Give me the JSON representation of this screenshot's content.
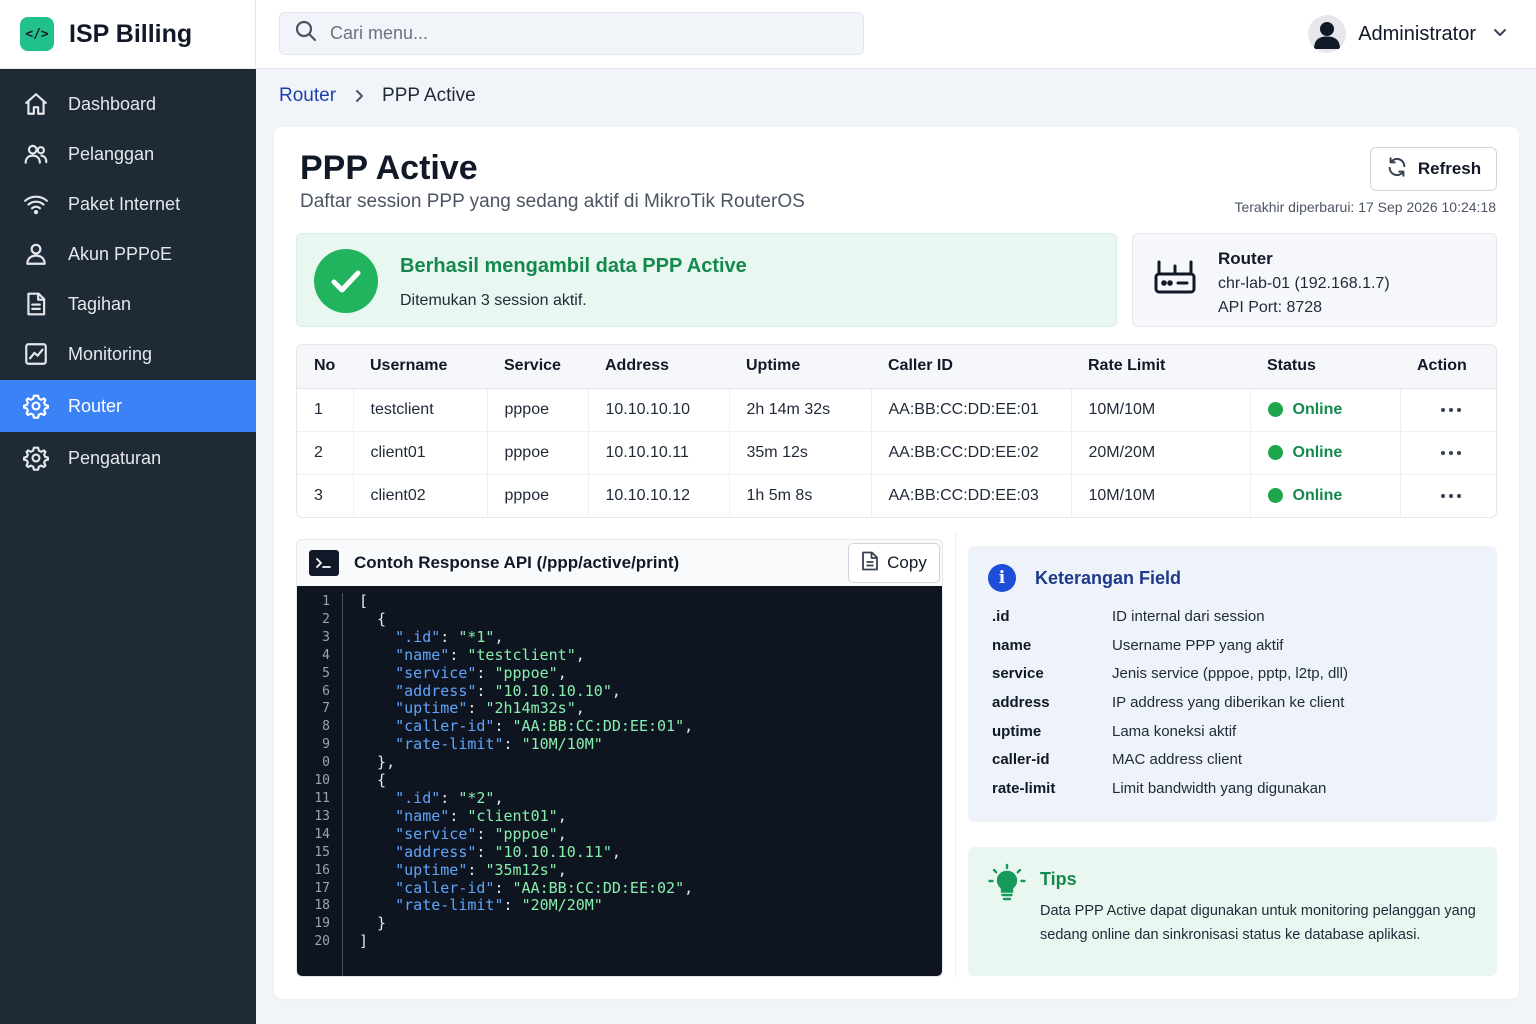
{
  "app": {
    "name": "ISP Billing",
    "logo_glyph": "</>",
    "accent": "#3b82f6",
    "brand_color": "#22c08a"
  },
  "search": {
    "placeholder": "Cari menu..."
  },
  "user": {
    "name": "Administrator"
  },
  "sidebar": {
    "items": [
      {
        "label": "Dashboard",
        "icon": "home-icon"
      },
      {
        "label": "Pelanggan",
        "icon": "users-icon"
      },
      {
        "label": "Paket Internet",
        "icon": "wifi-icon"
      },
      {
        "label": "Akun PPPoE",
        "icon": "user-icon"
      },
      {
        "label": "Tagihan",
        "icon": "invoice-icon"
      },
      {
        "label": "Monitoring",
        "icon": "chart-icon"
      },
      {
        "label": "Router",
        "icon": "gear-icon",
        "active": true
      },
      {
        "label": "Pengaturan",
        "icon": "gear-icon"
      }
    ]
  },
  "breadcrumb": {
    "parent": "Router",
    "current": "PPP Active"
  },
  "page": {
    "title": "PPP Active",
    "subtitle": "Daftar session PPP yang sedang aktif di MikroTik RouterOS",
    "refresh_label": "Refresh",
    "last_updated": "Terakhir diperbarui: 17 Sep 2026 10:24:18"
  },
  "alert": {
    "title": "Berhasil mengambil data PPP Active",
    "message": "Ditemukan 3 session aktif."
  },
  "router": {
    "label": "Router",
    "name": "chr-lab-01 (192.168.1.7)",
    "api_port": "API Port: 8728"
  },
  "table": {
    "headers": [
      "No",
      "Username",
      "Service",
      "Address",
      "Uptime",
      "Caller ID",
      "Rate Limit",
      "Status",
      "Action"
    ],
    "rows": [
      {
        "no": "1",
        "username": "testclient",
        "service": "pppoe",
        "address": "10.10.10.10",
        "uptime": "2h 14m 32s",
        "caller_id": "AA:BB:CC:DD:EE:01",
        "rate_limit": "10M/10M",
        "status": "Online"
      },
      {
        "no": "2",
        "username": "client01",
        "service": "pppoe",
        "address": "10.10.10.11",
        "uptime": "35m 12s",
        "caller_id": "AA:BB:CC:DD:EE:02",
        "rate_limit": "20M/20M",
        "status": "Online"
      },
      {
        "no": "3",
        "username": "client02",
        "service": "pppoe",
        "address": "10.10.10.12",
        "uptime": "1h 5m 8s",
        "caller_id": "AA:BB:CC:DD:EE:03",
        "rate_limit": "10M/10M",
        "status": "Online"
      }
    ]
  },
  "code_sample": {
    "title": "Contoh Response API (/ppp/active/print)",
    "copy_label": "Copy",
    "line_numbers": [
      "1",
      "2",
      "3",
      "4",
      "5",
      "6",
      "7",
      "8",
      "9",
      "0",
      "10",
      "11",
      "13",
      "14",
      "15",
      "16",
      "17",
      "18",
      "19",
      "20"
    ],
    "lines": [
      "[",
      "  {",
      "    \".id\": \"*1\",",
      "    \"name\": \"testclient\",",
      "    \"service\": \"pppoe\",",
      "    \"address\": \"10.10.10.10\",",
      "    \"uptime\": \"2h14m32s\",",
      "    \"caller-id\": \"AA:BB:CC:DD:EE:01\",",
      "    \"rate-limit\": \"10M/10M\"",
      "  },",
      "  {",
      "    \".id\": \"*2\",",
      "    \"name\": \"client01\",",
      "    \"service\": \"pppoe\",",
      "    \"address\": \"10.10.10.11\",",
      "    \"uptime\": \"35m12s\",",
      "    \"caller-id\": \"AA:BB:CC:DD:EE:02\",",
      "    \"rate-limit\": \"20M/20M\"",
      "  }",
      "]"
    ]
  },
  "field_info": {
    "title": "Keterangan Field",
    "fields": [
      {
        "key": ".id",
        "desc": "ID internal dari session"
      },
      {
        "key": "name",
        "desc": "Username PPP yang aktif"
      },
      {
        "key": "service",
        "desc": "Jenis service (pppoe, pptp, l2tp, dll)"
      },
      {
        "key": "address",
        "desc": "IP address yang diberikan ke client"
      },
      {
        "key": "uptime",
        "desc": "Lama koneksi aktif"
      },
      {
        "key": "caller-id",
        "desc": "MAC address client"
      },
      {
        "key": "rate-limit",
        "desc": "Limit bandwidth yang digunakan"
      }
    ]
  },
  "tips": {
    "title": "Tips",
    "text": "Data PPP Active dapat digunakan untuk monitoring pelanggan yang sedang online dan sinkronisasi status ke database aplikasi."
  }
}
